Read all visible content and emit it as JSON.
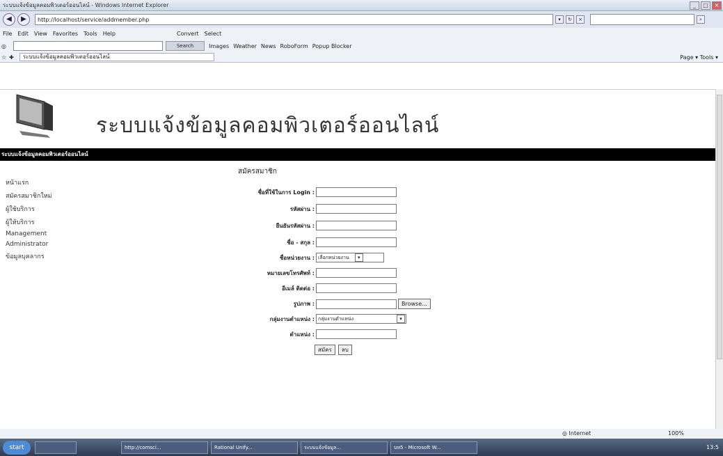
{
  "window": {
    "title": "ระบบแจ้งข้อมูลคอมพิวเตอร์ออนไลน์ - Windows Internet Explorer"
  },
  "address": {
    "url": "http://localhost/service/addmember.php",
    "search_placeholder": ""
  },
  "menu": [
    "File",
    "Edit",
    "View",
    "Favorites",
    "Tools",
    "Help"
  ],
  "convert": "Convert",
  "select": "Select",
  "gbar": {
    "links": [
      "Images",
      "Weather",
      "News",
      "RoboForm",
      "Popup Blocker"
    ],
    "search_btn": "Search"
  },
  "tab": {
    "title": "ระบบแจ้งข้อมูลคอมพิวเตอร์ออนไลน์"
  },
  "tools": "Page ▾  Tools ▾",
  "site": {
    "title": "ระบบแจ้งข้อมูลคอมพิวเตอร์ออนไลน์",
    "bar": "ระบบแจ้งข้อมูลคอมพิวเตอร์ออนไลน์"
  },
  "sidebar": [
    {
      "label": "หน้าแรก"
    },
    {
      "label": "สมัครสมาชิกใหม่"
    },
    {
      "label": "ผู้ใช้บริการ"
    },
    {
      "label": "ผู้ให้บริการ"
    },
    {
      "label": "Management"
    },
    {
      "label": "Administrator"
    },
    {
      "label": "ข้อมูลบุคลากร"
    }
  ],
  "form": {
    "heading": "สมัครสมาชิก",
    "fields": {
      "login": "ชื่อที่ใช้ในการ Login :",
      "password": "รหัสผ่าน :",
      "confirm": "ยืนยันรหัสผ่าน :",
      "name": "ชื่อ - สกุล :",
      "dept": "ชื่อหน่วยงาน :",
      "phone": "หมายเลขโทรศัพท์ :",
      "email": "อีเมล์ ติดต่อ :",
      "photo": "รูปภาพ :",
      "group": "กลุ่มงานตำแหน่ง :",
      "position": "ตำแหน่ง :"
    },
    "dept_value": "เลือกหน่วยงาน",
    "group_value": "กลุ่มงานตำแหน่ง",
    "browse": "Browse...",
    "submit": "สมัคร",
    "reset": "ลบ"
  },
  "status": {
    "zone": "Internet",
    "zoom": "100%"
  },
  "taskbar": {
    "start": "start",
    "tasks": [
      "",
      "http://comsci...",
      "Rational Unify...",
      "ระบบแจ้งข้อมูล...",
      "บท5 - Microsoft W..."
    ],
    "clock": "13:5"
  }
}
